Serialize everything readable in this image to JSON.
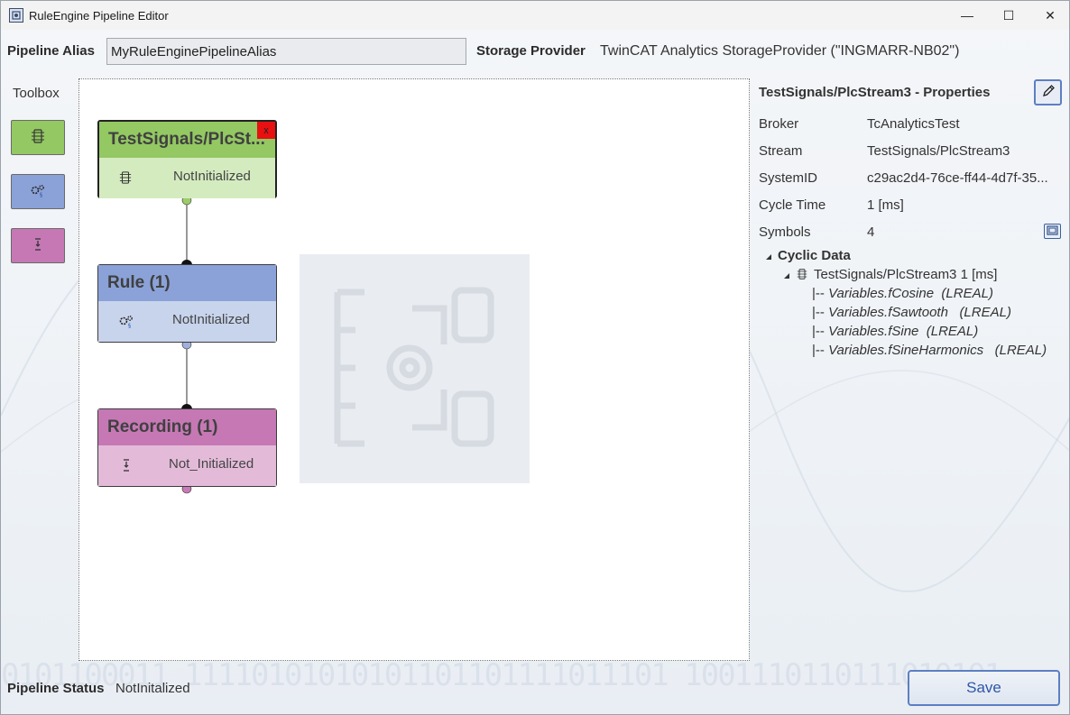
{
  "window": {
    "title": "RuleEngine Pipeline Editor",
    "controls": {
      "minimize": "—",
      "maximize": "☐",
      "close": "✕"
    }
  },
  "header": {
    "alias_label": "Pipeline Alias",
    "alias_value": "MyRuleEnginePipelineAlias",
    "storage_label": "Storage Provider",
    "storage_value": "TwinCAT Analytics StorageProvider (\"INGMARR-NB02\")"
  },
  "toolbox": {
    "title": "Toolbox",
    "items": [
      {
        "name": "stream-tool",
        "icon": "stream-icon",
        "color": "#93c862"
      },
      {
        "name": "rule-tool",
        "icon": "gears-icon",
        "color": "#8ba2d8"
      },
      {
        "name": "recording-tool",
        "icon": "recording-icon",
        "color": "#c678b5"
      }
    ]
  },
  "nodes": [
    {
      "title": "TestSignals/PlcSt...",
      "status": "NotInitialized",
      "icon": "stream-icon",
      "head_color": "#93c862",
      "body_color": "#d4ebc0",
      "close_label": "x"
    },
    {
      "title": "Rule (1)",
      "status": "NotInitialized",
      "icon": "gears-icon",
      "head_color": "#8ba2d8",
      "body_color": "#c8d4ec"
    },
    {
      "title": "Recording (1)",
      "status": "Not_Initialized",
      "icon": "recording-icon",
      "head_color": "#c678b5",
      "body_color": "#e3bbd9"
    }
  ],
  "properties": {
    "title": "TestSignals/PlcStream3 - Properties",
    "rows": [
      {
        "label": "Broker",
        "value": "TcAnalyticsTest"
      },
      {
        "label": "Stream",
        "value": "TestSignals/PlcStream3"
      },
      {
        "label": "SystemID",
        "value": "c29ac2d4-76ce-ff44-4d7f-35..."
      },
      {
        "label": "Cycle Time",
        "value": "1 [ms]"
      },
      {
        "label": "Symbols",
        "value": "4"
      }
    ],
    "tree": {
      "root": "Cyclic Data",
      "stream": "TestSignals/PlcStream3 1 [ms]",
      "symbols": [
        {
          "prefix": "|-- ",
          "name": "Variables.fCosine",
          "type": "(LREAL)"
        },
        {
          "prefix": "|-- ",
          "name": "Variables.fSawtooth",
          "type": "(LREAL)"
        },
        {
          "prefix": "|-- ",
          "name": "Variables.fSine",
          "type": "(LREAL)"
        },
        {
          "prefix": "|-- ",
          "name": "Variables.fSineHarmonics",
          "type": "(LREAL)"
        }
      ]
    }
  },
  "footer": {
    "status_label": "Pipeline Status",
    "status_value": "NotInitalized",
    "save_label": "Save"
  }
}
